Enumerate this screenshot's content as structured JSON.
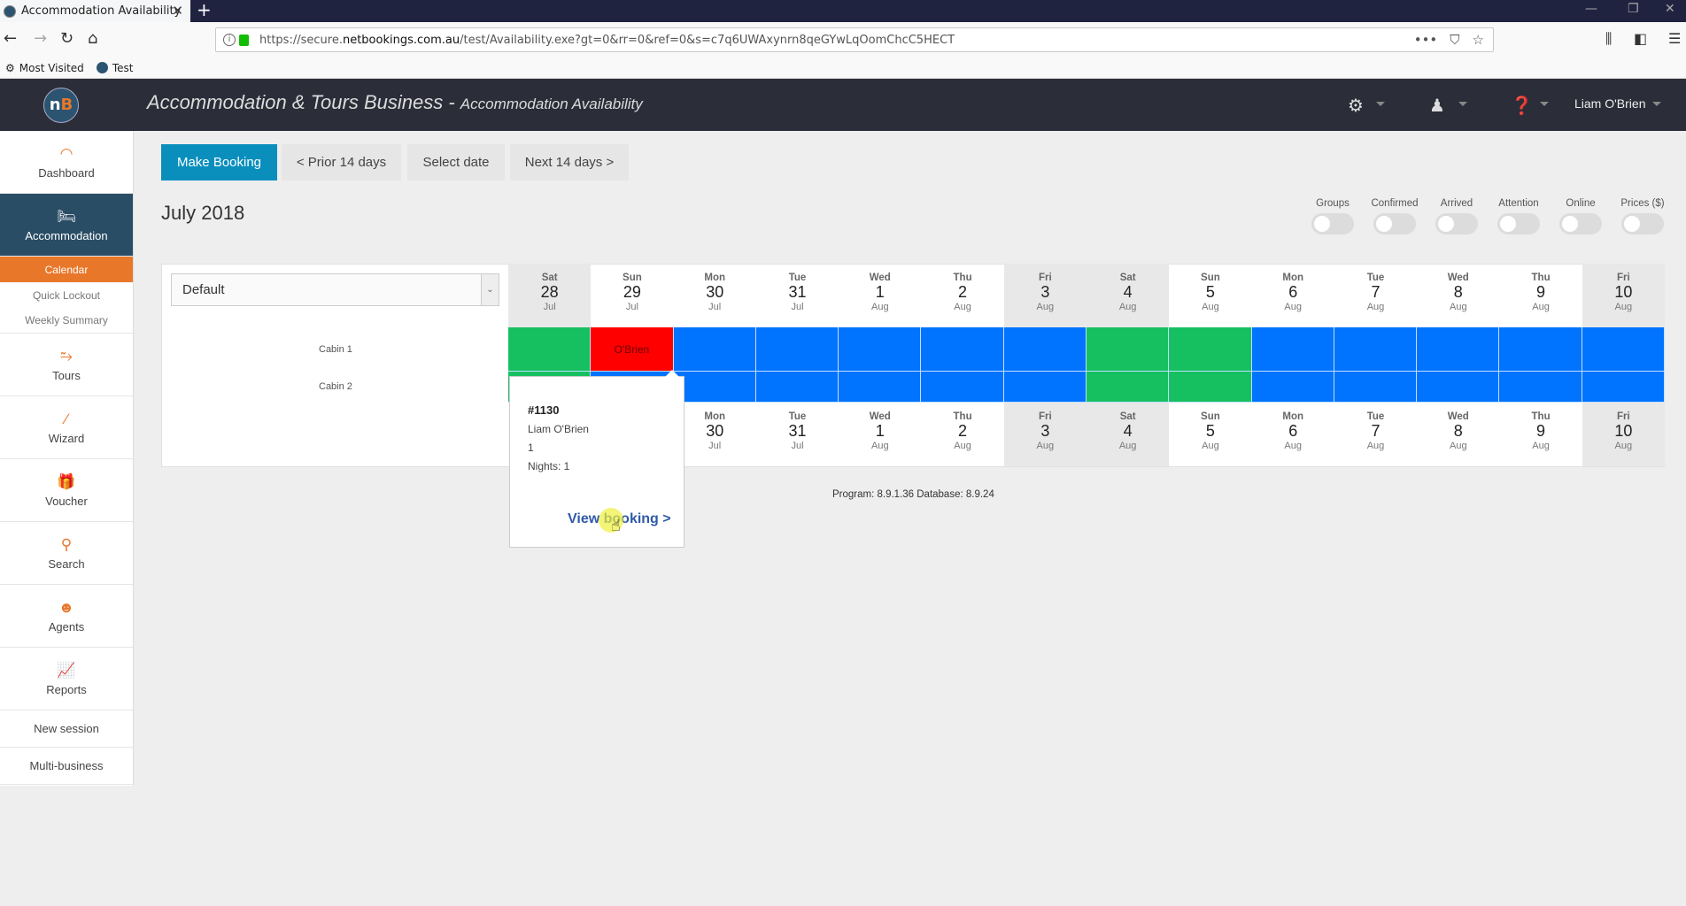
{
  "browser": {
    "tab_title": "Accommodation Availability",
    "url_prefix": "https://secure.",
    "url_domain": "netbookings.com.au",
    "url_suffix": "/test/Availability.exe?gt=0&rr=0&ref=0&s=c7q6UWAxynrn8qeGYwLqOomChcC5HECT",
    "bookmarks": [
      "Most Visited",
      "Test"
    ]
  },
  "header": {
    "title": "Accommodation & Tours Business - ",
    "subtitle": "Accommodation Availability",
    "user": "Liam O'Brien"
  },
  "sidebar": {
    "items": [
      {
        "label": "Dashboard",
        "icon": "gauge-icon"
      },
      {
        "label": "Accommodation",
        "icon": "bed-icon"
      },
      {
        "label": "Tours",
        "icon": "route-icon"
      },
      {
        "label": "Wizard",
        "icon": "magic-wand-icon"
      },
      {
        "label": "Voucher",
        "icon": "gift-icon"
      },
      {
        "label": "Search",
        "icon": "search-icon"
      },
      {
        "label": "Agents",
        "icon": "agent-icon"
      },
      {
        "label": "Reports",
        "icon": "chart-icon"
      },
      {
        "label": "New session"
      },
      {
        "label": "Multi-business"
      }
    ],
    "subitems": [
      "Calendar",
      "Quick Lockout",
      "Weekly Summary"
    ]
  },
  "toolbar": {
    "make_booking": "Make Booking",
    "prior": "< Prior 14 days",
    "select_date": "Select date",
    "next": "Next 14 days >"
  },
  "month_label": "July 2018",
  "toggles": [
    "Groups",
    "Confirmed",
    "Arrived",
    "Attention",
    "Online",
    "Prices ($)"
  ],
  "filter": {
    "selected": "Default"
  },
  "days": [
    {
      "dn": "Sat",
      "dd": "28",
      "dm": "Jul",
      "we": true
    },
    {
      "dn": "Sun",
      "dd": "29",
      "dm": "Jul",
      "we": false
    },
    {
      "dn": "Mon",
      "dd": "30",
      "dm": "Jul",
      "we": false
    },
    {
      "dn": "Tue",
      "dd": "31",
      "dm": "Jul",
      "we": false
    },
    {
      "dn": "Wed",
      "dd": "1",
      "dm": "Aug",
      "we": false
    },
    {
      "dn": "Thu",
      "dd": "2",
      "dm": "Aug",
      "we": false
    },
    {
      "dn": "Fri",
      "dd": "3",
      "dm": "Aug",
      "we": true
    },
    {
      "dn": "Sat",
      "dd": "4",
      "dm": "Aug",
      "we": true
    },
    {
      "dn": "Sun",
      "dd": "5",
      "dm": "Aug",
      "we": false
    },
    {
      "dn": "Mon",
      "dd": "6",
      "dm": "Aug",
      "we": false
    },
    {
      "dn": "Tue",
      "dd": "7",
      "dm": "Aug",
      "we": false
    },
    {
      "dn": "Wed",
      "dd": "8",
      "dm": "Aug",
      "we": false
    },
    {
      "dn": "Thu",
      "dd": "9",
      "dm": "Aug",
      "we": false
    },
    {
      "dn": "Fri",
      "dd": "10",
      "dm": "Aug",
      "we": true
    }
  ],
  "rooms": [
    {
      "name": "Cabin 1",
      "cells": [
        "free",
        "booked",
        "avail",
        "avail",
        "avail",
        "avail",
        "avail",
        "free",
        "free",
        "avail",
        "avail",
        "avail",
        "avail",
        "avail"
      ],
      "booking_label": "O'Brien"
    },
    {
      "name": "Cabin 2",
      "cells": [
        "free",
        "avail",
        "avail",
        "avail",
        "avail",
        "avail",
        "avail",
        "free",
        "free",
        "avail",
        "avail",
        "avail",
        "avail",
        "avail"
      ]
    }
  ],
  "tooltip": {
    "ref": "#1130",
    "guest": "Liam O'Brien",
    "qty": "1",
    "nights": "Nights: 1",
    "view": "View booking >"
  },
  "version": "Program: 8.9.1.36 Database: 8.9.24"
}
